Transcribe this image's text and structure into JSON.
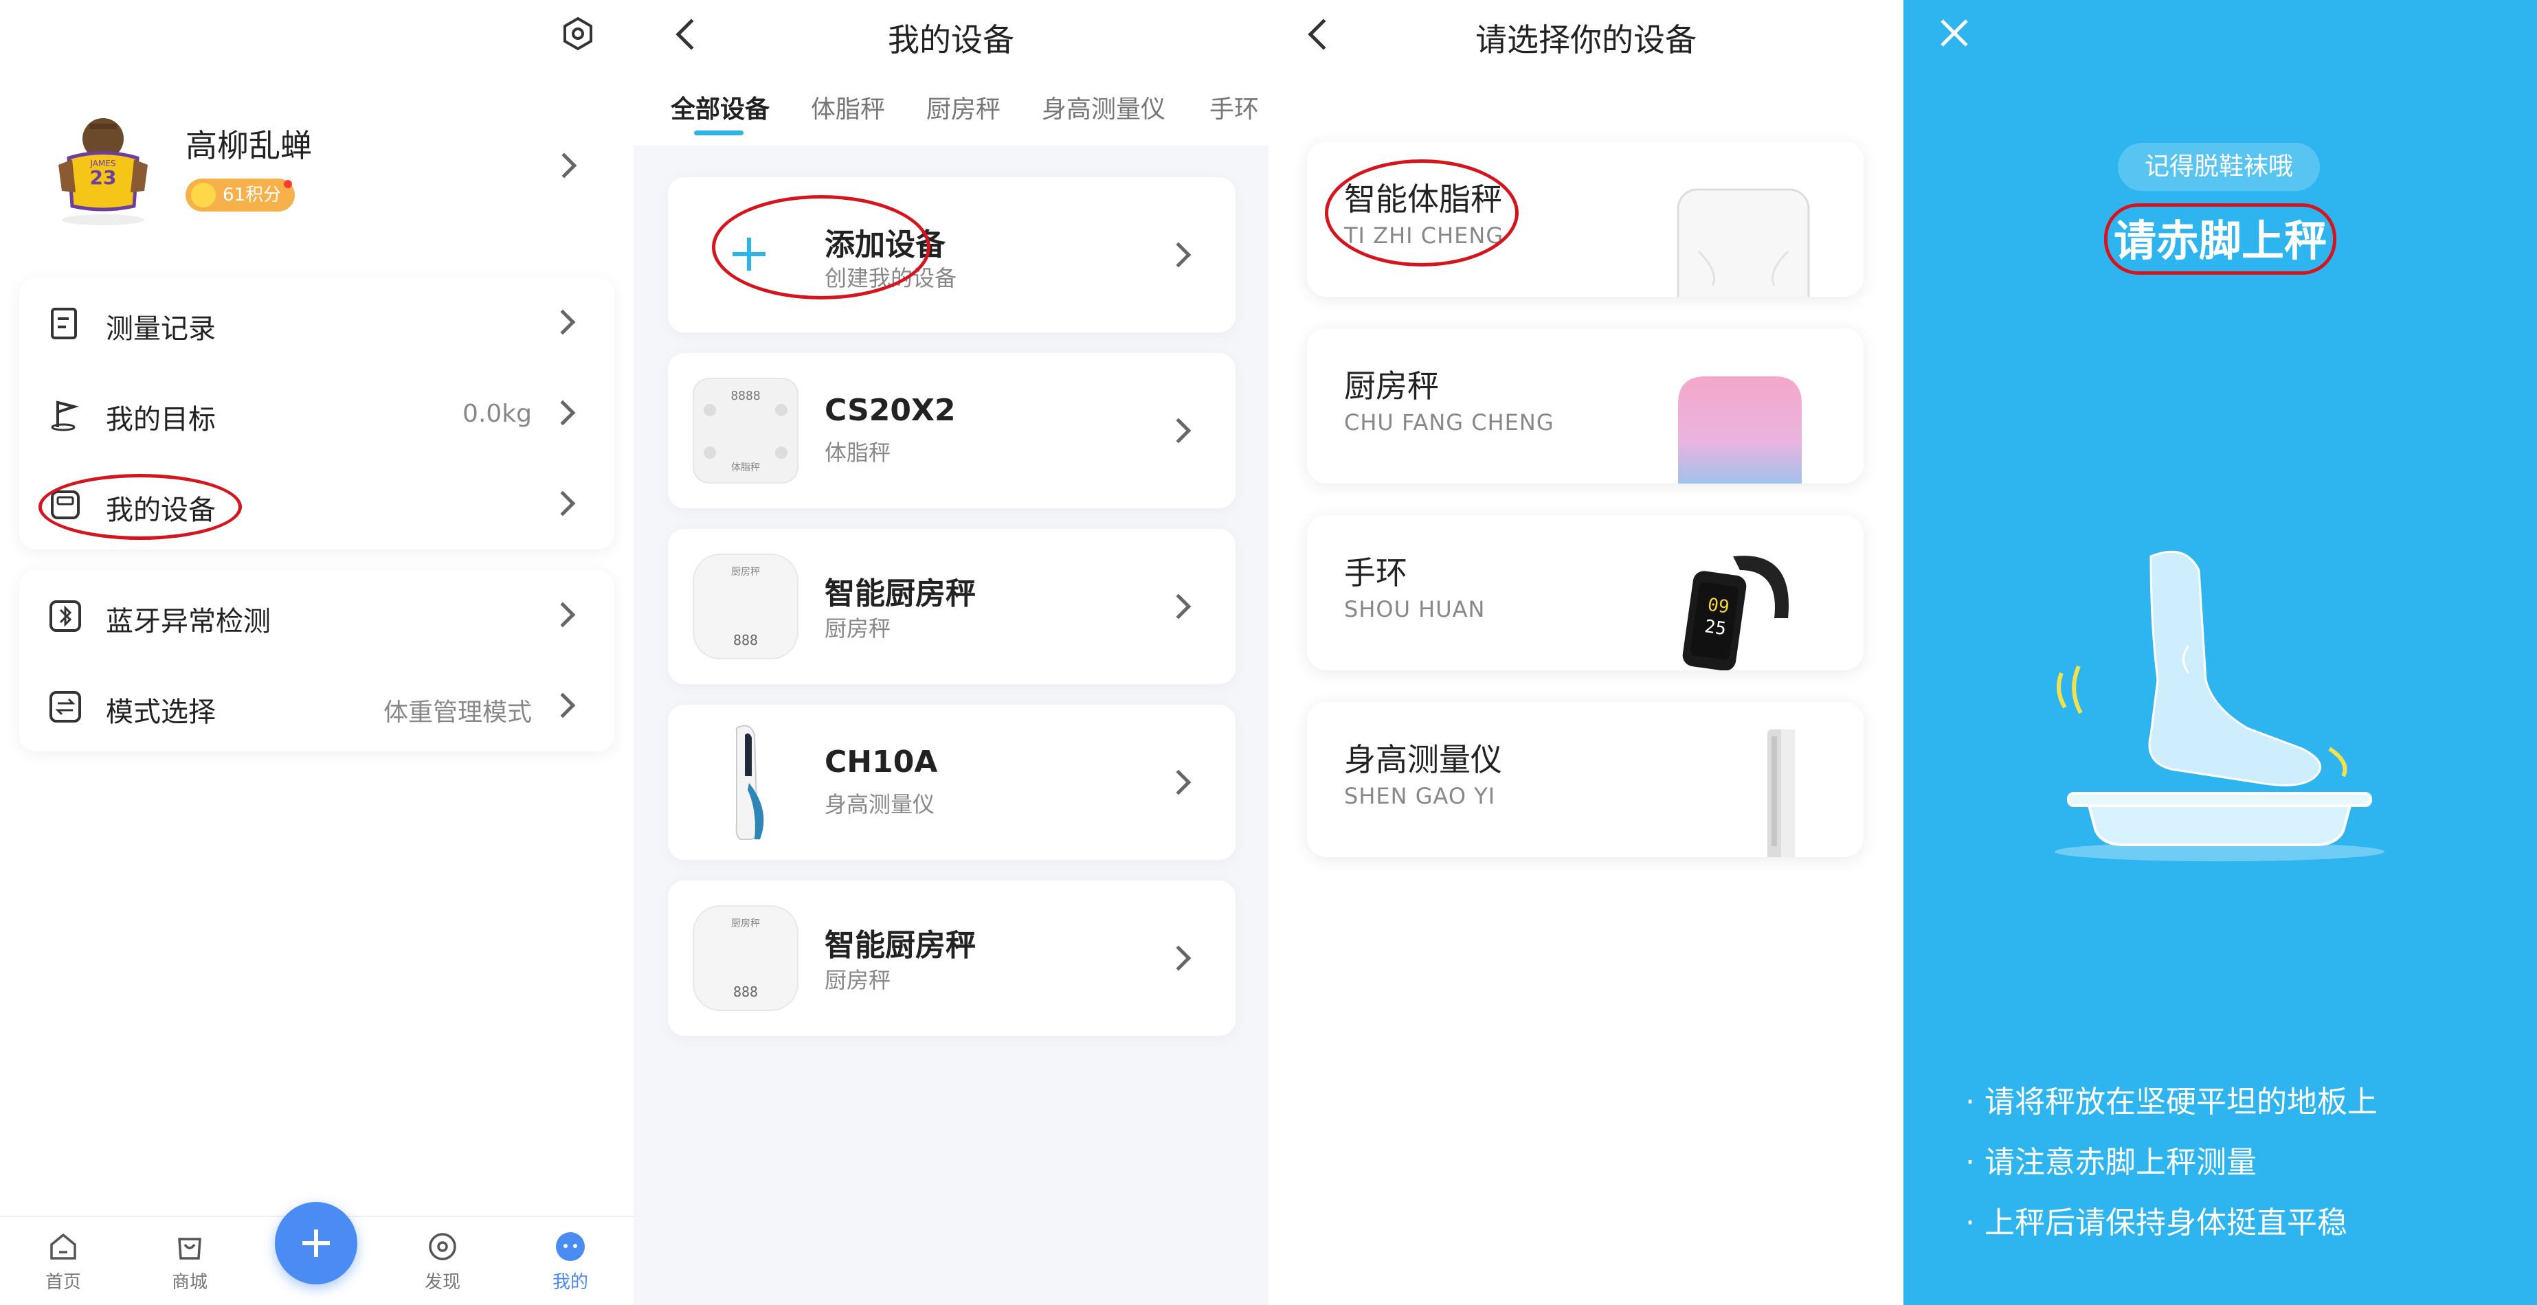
{
  "profile": {
    "user_name": "高柳乱蝉",
    "points_badge": "61积分",
    "settings_icon": "settings-hex-icon"
  },
  "menu_group1": [
    {
      "label": "测量记录",
      "value": "",
      "icon": "record-icon"
    },
    {
      "label": "我的目标",
      "value": "0.0kg",
      "icon": "goal-flag-icon"
    },
    {
      "label": "我的设备",
      "value": "",
      "icon": "device-icon"
    }
  ],
  "menu_group2": [
    {
      "label": "蓝牙异常检测",
      "value": "",
      "icon": "bluetooth-icon"
    },
    {
      "label": "模式选择",
      "value": "体重管理模式",
      "icon": "mode-switch-icon"
    }
  ],
  "bottom_tabs": [
    {
      "label": "首页",
      "icon": "home-icon",
      "active": false
    },
    {
      "label": "商城",
      "icon": "shop-bag-icon",
      "active": false
    },
    {
      "label": "发现",
      "icon": "discover-icon",
      "active": false
    },
    {
      "label": "我的",
      "icon": "me-icon",
      "active": true
    }
  ],
  "colors": {
    "accent": "#4b8bf4",
    "tab_underline": "#2bb3ea",
    "right_panel_bg": "#2eb5ef",
    "highlight_ring": "#d6141e",
    "points_badge_bg": "#f6b14b"
  },
  "devices_screen": {
    "title": "我的设备",
    "tabs": [
      "全部设备",
      "体脂秤",
      "厨房秤",
      "身高测量仪",
      "手环"
    ],
    "active_tab": "全部设备",
    "add_device": {
      "title": "添加设备",
      "subtitle": "创建我的设备"
    },
    "devices": [
      {
        "name": "CS20X2",
        "type": "体脂秤",
        "thumb_text": "8888",
        "thumb_label": "体脂秤"
      },
      {
        "name": "智能厨房秤",
        "type": "厨房秤",
        "thumb_text": "888",
        "thumb_label": "厨房秤"
      },
      {
        "name": "CH10A",
        "type": "身高测量仪",
        "thumb_text": "",
        "thumb_label": ""
      },
      {
        "name": "智能厨房秤",
        "type": "厨房秤",
        "thumb_text": "888",
        "thumb_label": "厨房秤"
      }
    ]
  },
  "select_screen": {
    "title": "请选择你的设备",
    "options": [
      {
        "name": "智能体脂秤",
        "pinyin": "TI ZHI CHENG"
      },
      {
        "name": "厨房秤",
        "pinyin": "CHU FANG CHENG"
      },
      {
        "name": "手环",
        "pinyin": "SHOU HUAN"
      },
      {
        "name": "身高测量仪",
        "pinyin": "SHEN GAO YI"
      }
    ],
    "band_digits_top": "09",
    "band_digits_bottom": "25"
  },
  "instruction_screen": {
    "bubble_text": "记得脱鞋袜哦",
    "heading": "请赤脚上秤",
    "tips": [
      "· 请将秤放在坚硬平坦的地板上",
      "· 请注意赤脚上秤测量",
      "· 上秤后请保持身体挺直平稳"
    ]
  }
}
